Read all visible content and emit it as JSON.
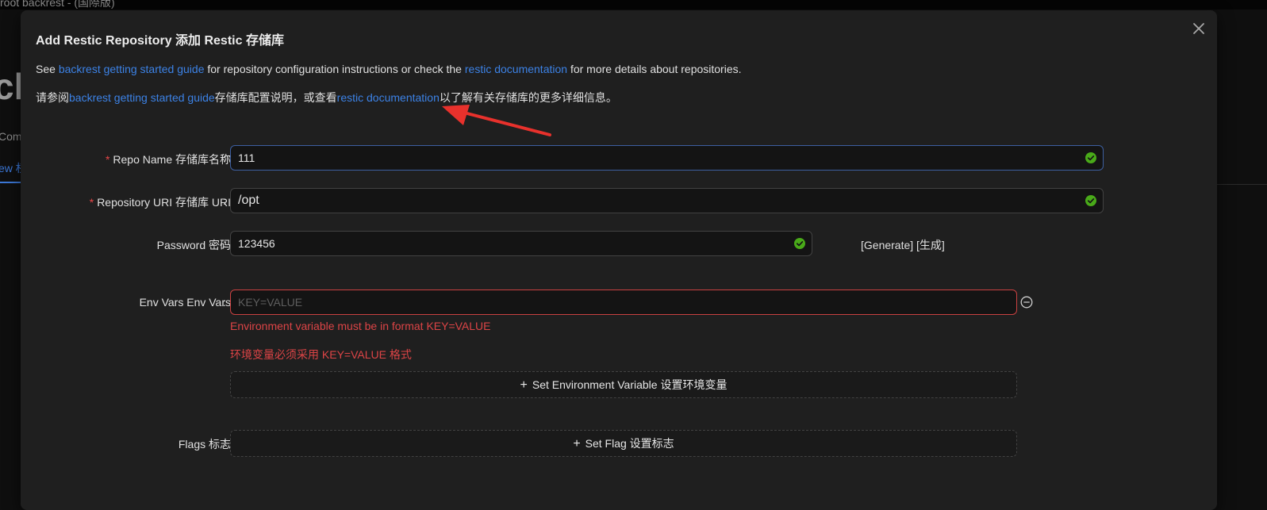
{
  "background": {
    "window_title": "root backrest - (国際版)",
    "big_text": "ck",
    "side_label": "Com",
    "tab_label": "ew 权"
  },
  "modal": {
    "title": "Add Restic Repository 添加 Restic 存储库",
    "intro_en": {
      "prefix": "See ",
      "link1": "backrest getting started guide",
      "middle": " for repository configuration instructions or check the ",
      "link2": "restic documentation",
      "suffix": " for more details about repositories."
    },
    "intro_zh": {
      "prefix": "请参阅",
      "link1": "backrest getting started guide",
      "middle": "存储库配置说明，或查看",
      "link2": "restic documentation",
      "suffix": "以了解有关存储库的更多详细信息。"
    },
    "form": {
      "repo_name": {
        "required_mark": "*",
        "label": "Repo Name 存储库名称",
        "value": "111",
        "valid": true
      },
      "repo_uri": {
        "required_mark": "*",
        "label": "Repository URI 存储库 URI",
        "value": "/opt",
        "valid": true
      },
      "password": {
        "label": "Password 密码",
        "value": "123456",
        "valid": true,
        "generate_label": "[Generate] [生成]"
      },
      "env_vars": {
        "label": "Env Vars Env Vars",
        "placeholder": "KEY=VALUE",
        "error_en": "Environment variable must be in format KEY=VALUE",
        "error_zh": "环境变量必须采用 KEY=VALUE 格式",
        "add_label": "Set Environment Variable 设置环境变量"
      },
      "flags": {
        "label": "Flags 标志",
        "add_label": "Set Flag 设置标志"
      },
      "colon": ":"
    }
  },
  "colors": {
    "link": "#3c82e6",
    "error": "#dc4446",
    "valid": "#49aa19",
    "annotation_arrow": "#e8312c"
  }
}
